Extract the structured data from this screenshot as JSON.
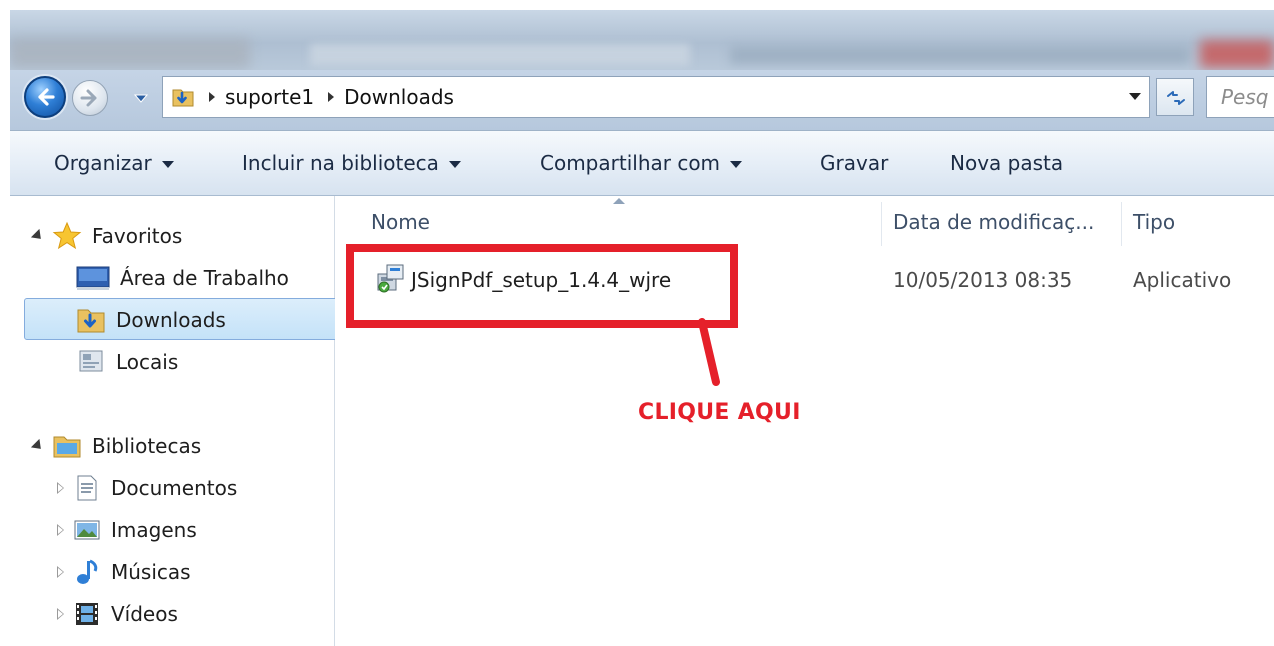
{
  "navigation": {
    "breadcrumbs": [
      "suporte1",
      "Downloads"
    ],
    "search_placeholder": "Pesq"
  },
  "commands": {
    "organize": "Organizar",
    "include_library": "Incluir na biblioteca",
    "share_with": "Compartilhar com",
    "burn": "Gravar",
    "new_folder": "Nova pasta"
  },
  "sidebar": {
    "favorites": {
      "title": "Favoritos",
      "items": [
        "Área de Trabalho",
        "Downloads",
        "Locais"
      ]
    },
    "libraries": {
      "title": "Bibliotecas",
      "items": [
        "Documentos",
        "Imagens",
        "Músicas",
        "Vídeos"
      ]
    },
    "selected": "Downloads"
  },
  "file_list": {
    "columns": [
      "Nome",
      "Data de modificaç...",
      "Tipo"
    ],
    "rows": [
      {
        "name": "JSignPdf_setup_1.4.4_wjre",
        "date": "10/05/2013 08:35",
        "type": "Aplicativo"
      }
    ]
  },
  "annotation": {
    "callout": "CLIQUE AQUI",
    "color": "#e5202a"
  },
  "colors": {
    "selection_bg": "#c4e2f8",
    "selection_border": "#84acdd",
    "command_text": "#1b2b44"
  }
}
